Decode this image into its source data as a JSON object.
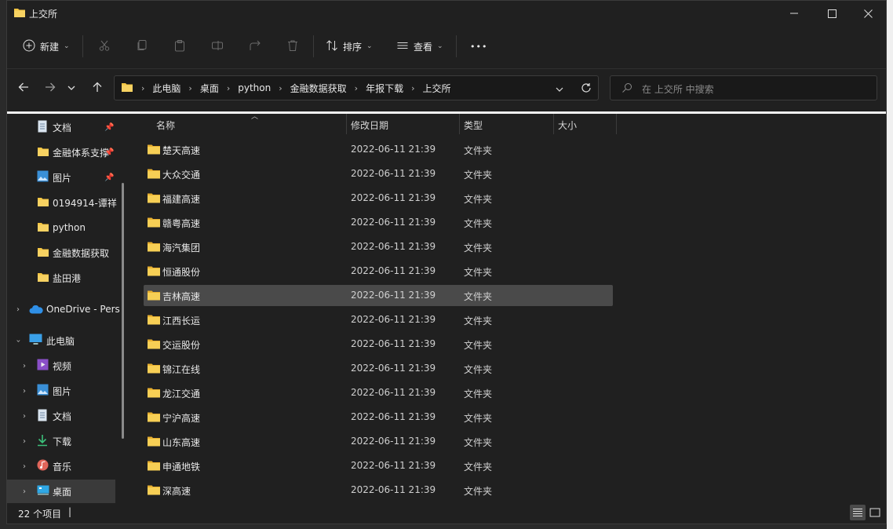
{
  "window": {
    "title": "上交所"
  },
  "toolbar": {
    "new_label": "新建",
    "sort_label": "排序",
    "view_label": "查看",
    "more_label": "•••"
  },
  "address": {
    "crumbs": [
      "此电脑",
      "桌面",
      "python",
      "金融数据获取",
      "年报下载",
      "上交所"
    ]
  },
  "search": {
    "placeholder": "在 上交所 中搜索"
  },
  "sidebar": {
    "items": [
      {
        "label": "文档",
        "icon": "document-icon",
        "pinned": true
      },
      {
        "label": "金融体系支撑",
        "icon": "folder-icon",
        "pinned": true
      },
      {
        "label": "图片",
        "icon": "picture-icon",
        "pinned": true
      },
      {
        "label": "0194914-谭祥",
        "icon": "folder-icon"
      },
      {
        "label": "python",
        "icon": "folder-icon"
      },
      {
        "label": "金融数据获取",
        "icon": "folder-icon"
      },
      {
        "label": "盐田港",
        "icon": "folder-icon"
      },
      {
        "label": "OneDrive - Pers",
        "icon": "cloud-icon"
      },
      {
        "label": "此电脑",
        "icon": "computer-icon"
      },
      {
        "label": "视频",
        "icon": "video-icon"
      },
      {
        "label": "图片",
        "icon": "picture-icon"
      },
      {
        "label": "文档",
        "icon": "document-icon"
      },
      {
        "label": "下载",
        "icon": "download-icon"
      },
      {
        "label": "音乐",
        "icon": "music-icon"
      },
      {
        "label": "桌面",
        "icon": "desktop-icon"
      }
    ]
  },
  "columns": {
    "name": "名称",
    "date": "修改日期",
    "type": "类型",
    "size": "大小"
  },
  "files": [
    {
      "name": "楚天高速",
      "date": "2022-06-11 21:39",
      "type": "文件夹"
    },
    {
      "name": "大众交通",
      "date": "2022-06-11 21:39",
      "type": "文件夹"
    },
    {
      "name": "福建高速",
      "date": "2022-06-11 21:39",
      "type": "文件夹"
    },
    {
      "name": "赣粤高速",
      "date": "2022-06-11 21:39",
      "type": "文件夹"
    },
    {
      "name": "海汽集团",
      "date": "2022-06-11 21:39",
      "type": "文件夹"
    },
    {
      "name": "恒通股份",
      "date": "2022-06-11 21:39",
      "type": "文件夹"
    },
    {
      "name": "吉林高速",
      "date": "2022-06-11 21:39",
      "type": "文件夹"
    },
    {
      "name": "江西长运",
      "date": "2022-06-11 21:39",
      "type": "文件夹"
    },
    {
      "name": "交运股份",
      "date": "2022-06-11 21:39",
      "type": "文件夹"
    },
    {
      "name": "锦江在线",
      "date": "2022-06-11 21:39",
      "type": "文件夹"
    },
    {
      "name": "龙江交通",
      "date": "2022-06-11 21:39",
      "type": "文件夹"
    },
    {
      "name": "宁沪高速",
      "date": "2022-06-11 21:39",
      "type": "文件夹"
    },
    {
      "name": "山东高速",
      "date": "2022-06-11 21:39",
      "type": "文件夹"
    },
    {
      "name": "申通地铁",
      "date": "2022-06-11 21:39",
      "type": "文件夹"
    },
    {
      "name": "深高速",
      "date": "2022-06-11 21:39",
      "type": "文件夹"
    }
  ],
  "status": {
    "count": "22 个项目",
    "cursor": "|"
  },
  "colors": {
    "folder": "#f4c542",
    "selected_row": "#4a4a4a",
    "background": "#202020"
  }
}
